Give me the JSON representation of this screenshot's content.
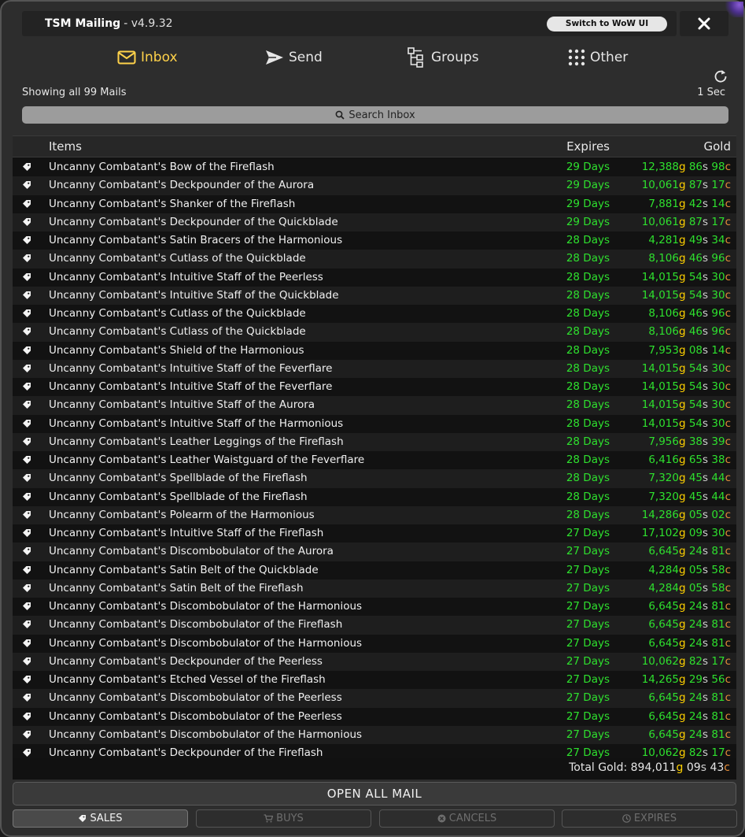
{
  "titlebar": {
    "title": "TSM Mailing",
    "version": " - v4.9.32",
    "switch_label": "Switch to WoW UI"
  },
  "tabs": [
    {
      "label": "Inbox",
      "icon": "envelope-icon",
      "active": true
    },
    {
      "label": "Send",
      "icon": "send-icon",
      "active": false
    },
    {
      "label": "Groups",
      "icon": "groups-icon",
      "active": false
    },
    {
      "label": "Other",
      "icon": "grid-dots-icon",
      "active": false
    }
  ],
  "status": {
    "mail_count": "Showing all 99 Mails",
    "refresh_time": "1 Sec"
  },
  "search": {
    "placeholder": "Search Inbox"
  },
  "table": {
    "headers": {
      "items": "Items",
      "expires": "Expires",
      "gold": "Gold"
    },
    "rows": [
      {
        "name": "Uncanny Combatant's Bow of the Fireflash",
        "expires": "29 Days",
        "gold": "12,388",
        "silver": "86",
        "copper": "98"
      },
      {
        "name": "Uncanny Combatant's Deckpounder of the Aurora",
        "expires": "29 Days",
        "gold": "10,061",
        "silver": "87",
        "copper": "17"
      },
      {
        "name": "Uncanny Combatant's Shanker of the Fireflash",
        "expires": "29 Days",
        "gold": "7,881",
        "silver": "42",
        "copper": "14"
      },
      {
        "name": "Uncanny Combatant's Deckpounder of the Quickblade",
        "expires": "29 Days",
        "gold": "10,061",
        "silver": "87",
        "copper": "17"
      },
      {
        "name": "Uncanny Combatant's Satin Bracers of the Harmonious",
        "expires": "28 Days",
        "gold": "4,281",
        "silver": "49",
        "copper": "34"
      },
      {
        "name": "Uncanny Combatant's Cutlass of the Quickblade",
        "expires": "28 Days",
        "gold": "8,106",
        "silver": "46",
        "copper": "96"
      },
      {
        "name": "Uncanny Combatant's Intuitive Staff of the Peerless",
        "expires": "28 Days",
        "gold": "14,015",
        "silver": "54",
        "copper": "30"
      },
      {
        "name": "Uncanny Combatant's Intuitive Staff of the Quickblade",
        "expires": "28 Days",
        "gold": "14,015",
        "silver": "54",
        "copper": "30"
      },
      {
        "name": "Uncanny Combatant's Cutlass of the Quickblade",
        "expires": "28 Days",
        "gold": "8,106",
        "silver": "46",
        "copper": "96"
      },
      {
        "name": "Uncanny Combatant's Cutlass of the Quickblade",
        "expires": "28 Days",
        "gold": "8,106",
        "silver": "46",
        "copper": "96"
      },
      {
        "name": "Uncanny Combatant's Shield of the Harmonious",
        "expires": "28 Days",
        "gold": "7,953",
        "silver": "08",
        "copper": "14"
      },
      {
        "name": "Uncanny Combatant's Intuitive Staff of the Feverflare",
        "expires": "28 Days",
        "gold": "14,015",
        "silver": "54",
        "copper": "30"
      },
      {
        "name": "Uncanny Combatant's Intuitive Staff of the Feverflare",
        "expires": "28 Days",
        "gold": "14,015",
        "silver": "54",
        "copper": "30"
      },
      {
        "name": "Uncanny Combatant's Intuitive Staff of the Aurora",
        "expires": "28 Days",
        "gold": "14,015",
        "silver": "54",
        "copper": "30"
      },
      {
        "name": "Uncanny Combatant's Intuitive Staff of the Harmonious",
        "expires": "28 Days",
        "gold": "14,015",
        "silver": "54",
        "copper": "30"
      },
      {
        "name": "Uncanny Combatant's Leather Leggings of the Fireflash",
        "expires": "28 Days",
        "gold": "7,956",
        "silver": "38",
        "copper": "39"
      },
      {
        "name": "Uncanny Combatant's Leather Waistguard of the Feverflare",
        "expires": "28 Days",
        "gold": "6,416",
        "silver": "65",
        "copper": "38"
      },
      {
        "name": "Uncanny Combatant's Spellblade of the Fireflash",
        "expires": "28 Days",
        "gold": "7,320",
        "silver": "45",
        "copper": "44"
      },
      {
        "name": "Uncanny Combatant's Spellblade of the Fireflash",
        "expires": "28 Days",
        "gold": "7,320",
        "silver": "45",
        "copper": "44"
      },
      {
        "name": "Uncanny Combatant's Polearm of the Harmonious",
        "expires": "28 Days",
        "gold": "14,286",
        "silver": "05",
        "copper": "02"
      },
      {
        "name": "Uncanny Combatant's Intuitive Staff of the Fireflash",
        "expires": "27 Days",
        "gold": "17,102",
        "silver": "09",
        "copper": "30"
      },
      {
        "name": "Uncanny Combatant's Discombobulator of the Aurora",
        "expires": "27 Days",
        "gold": "6,645",
        "silver": "24",
        "copper": "81"
      },
      {
        "name": "Uncanny Combatant's Satin Belt of the Quickblade",
        "expires": "27 Days",
        "gold": "4,284",
        "silver": "05",
        "copper": "58"
      },
      {
        "name": "Uncanny Combatant's Satin Belt of the Fireflash",
        "expires": "27 Days",
        "gold": "4,284",
        "silver": "05",
        "copper": "58"
      },
      {
        "name": "Uncanny Combatant's Discombobulator of the Harmonious",
        "expires": "27 Days",
        "gold": "6,645",
        "silver": "24",
        "copper": "81"
      },
      {
        "name": "Uncanny Combatant's Discombobulator of the Fireflash",
        "expires": "27 Days",
        "gold": "6,645",
        "silver": "24",
        "copper": "81"
      },
      {
        "name": "Uncanny Combatant's Discombobulator of the Harmonious",
        "expires": "27 Days",
        "gold": "6,645",
        "silver": "24",
        "copper": "81"
      },
      {
        "name": "Uncanny Combatant's Deckpounder of the Peerless",
        "expires": "27 Days",
        "gold": "10,062",
        "silver": "82",
        "copper": "17"
      },
      {
        "name": "Uncanny Combatant's Etched Vessel of the Fireflash",
        "expires": "27 Days",
        "gold": "14,265",
        "silver": "29",
        "copper": "56"
      },
      {
        "name": "Uncanny Combatant's Discombobulator of the Peerless",
        "expires": "27 Days",
        "gold": "6,645",
        "silver": "24",
        "copper": "81"
      },
      {
        "name": "Uncanny Combatant's Discombobulator of the Peerless",
        "expires": "27 Days",
        "gold": "6,645",
        "silver": "24",
        "copper": "81"
      },
      {
        "name": "Uncanny Combatant's Discombobulator of the Harmonious",
        "expires": "27 Days",
        "gold": "6,645",
        "silver": "24",
        "copper": "81"
      },
      {
        "name": "Uncanny Combatant's Deckpounder of the Fireflash",
        "expires": "27 Days",
        "gold": "10,062",
        "silver": "82",
        "copper": "17"
      }
    ],
    "unit_g": "g",
    "unit_s": "s",
    "unit_c": "c"
  },
  "total": {
    "label": "Total Gold: ",
    "gold": "894,011",
    "silver": "09",
    "copper": "43"
  },
  "actions": {
    "open_all": "OPEN ALL MAIL"
  },
  "filters": [
    {
      "label": "SALES",
      "icon": "tag-icon",
      "active": true
    },
    {
      "label": "BUYS",
      "icon": "cart-icon",
      "active": false
    },
    {
      "label": "CANCELS",
      "icon": "cancel-icon",
      "active": false
    },
    {
      "label": "EXPIRES",
      "icon": "clock-icon",
      "active": false
    }
  ],
  "colors": {
    "accent": "#ffd24a",
    "positive": "#2ee02e",
    "gold_unit": "#ffd100",
    "copper_unit": "#e58e3a"
  }
}
